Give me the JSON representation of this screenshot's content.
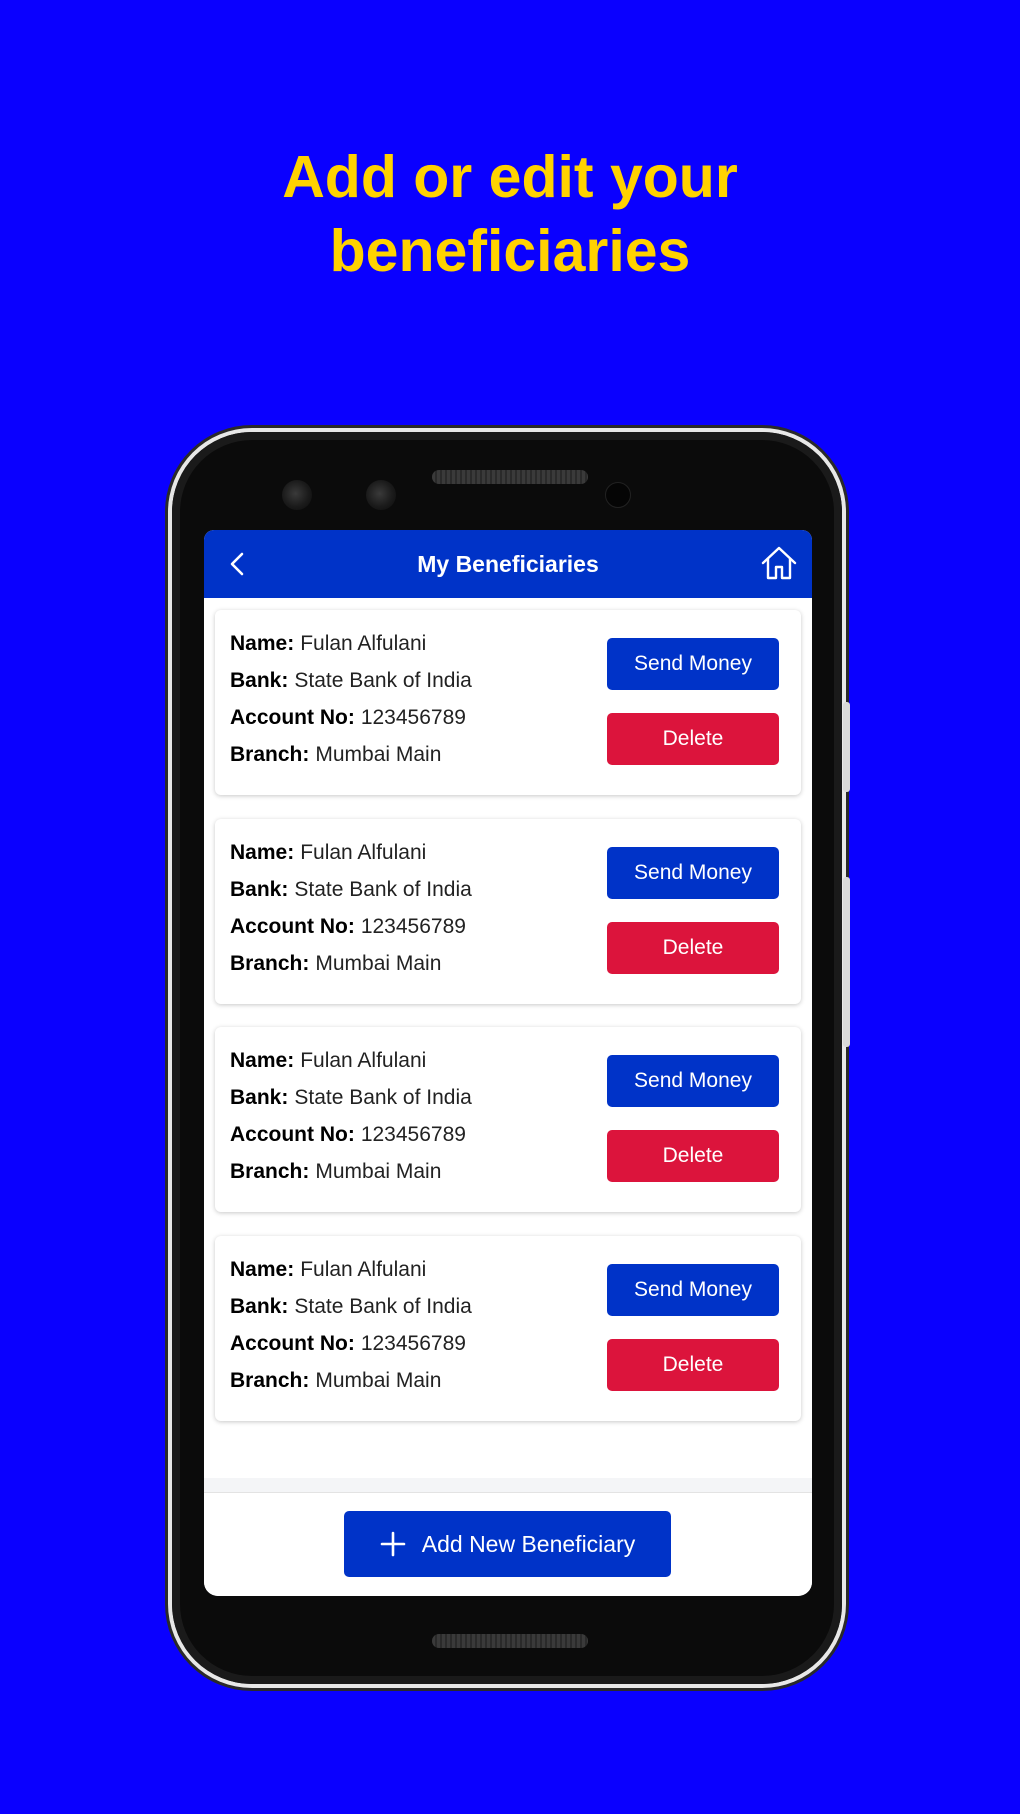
{
  "promo": {
    "line1": "Add or edit your",
    "line2": "beneficiaries"
  },
  "header": {
    "title": "My Beneficiaries",
    "back_icon": "chevron-left-icon",
    "home_icon": "home-icon"
  },
  "labels": {
    "name": "Name:",
    "bank": "Bank:",
    "account": "Account No:",
    "branch": "Branch:"
  },
  "beneficiaries": [
    {
      "name": "Fulan Alfulani",
      "bank": "State Bank of India",
      "account": "123456789",
      "branch": "Mumbai Main",
      "send_label": "Send Money",
      "delete_label": "Delete"
    },
    {
      "name": "Fulan Alfulani",
      "bank": "State Bank of India",
      "account": "123456789",
      "branch": "Mumbai Main",
      "send_label": "Send Money",
      "delete_label": "Delete"
    },
    {
      "name": "Fulan Alfulani",
      "bank": "State Bank of India",
      "account": "123456789",
      "branch": "Mumbai Main",
      "send_label": "Send Money",
      "delete_label": "Delete"
    },
    {
      "name": "Fulan Alfulani",
      "bank": "State Bank of India",
      "account": "123456789",
      "branch": "Mumbai Main",
      "send_label": "Send Money",
      "delete_label": "Delete"
    }
  ],
  "footer": {
    "add_label": "Add New Beneficiary",
    "add_icon": "plus-icon"
  },
  "colors": {
    "background": "#0a00ff",
    "headline": "#ffd200",
    "primary": "#0033c8",
    "danger": "#dc143c"
  }
}
